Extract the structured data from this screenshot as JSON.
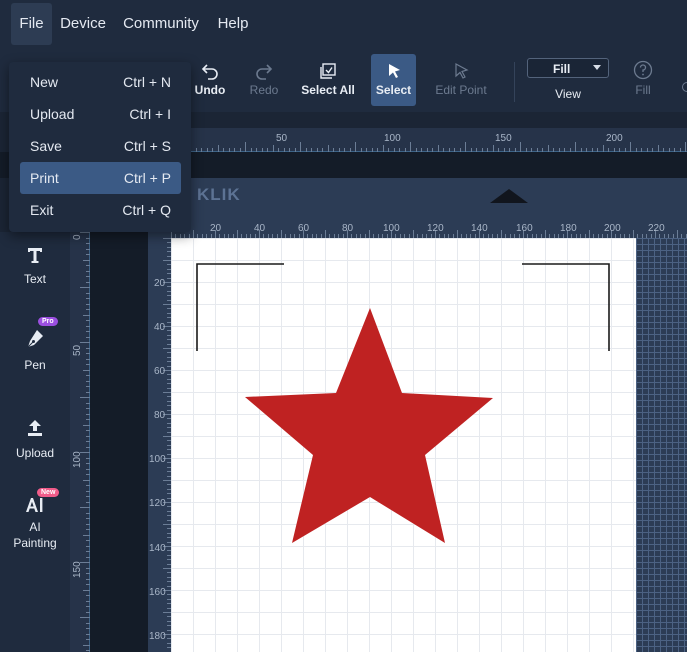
{
  "menubar": {
    "file": "File",
    "device": "Device",
    "community": "Community",
    "help": "Help"
  },
  "file_menu": {
    "items": [
      {
        "label": "New",
        "shortcut": "Ctrl + N"
      },
      {
        "label": "Upload",
        "shortcut": "Ctrl + I"
      },
      {
        "label": "Save",
        "shortcut": "Ctrl + S"
      },
      {
        "label": "Print",
        "shortcut": "Ctrl + P"
      },
      {
        "label": "Exit",
        "shortcut": "Ctrl + Q"
      }
    ],
    "highlighted": "Print"
  },
  "toolbar": {
    "undo": "Undo",
    "redo": "Redo",
    "select_all": "Select All",
    "select": "Select",
    "edit_point": "Edit Point",
    "fill_value": "Fill",
    "view": "View",
    "fill": "Fill"
  },
  "brand": "KLIK",
  "sidebar": {
    "text": "Text",
    "pen": "Pen",
    "pen_badge": "Pro",
    "upload": "Upload",
    "ai_line1": "AI",
    "ai_line2": "Painting",
    "ai_badge": "New"
  },
  "rulers": {
    "strip_top": [
      "50",
      "100",
      "150",
      "200"
    ],
    "strip_left": [
      "0",
      "50",
      "100",
      "150"
    ],
    "canvas_top": [
      "20",
      "40",
      "60",
      "80",
      "100",
      "120",
      "140",
      "160",
      "180",
      "200",
      "220"
    ],
    "canvas_left": [
      "20",
      "40",
      "60",
      "80",
      "100",
      "120",
      "140",
      "160",
      "180"
    ]
  },
  "colors": {
    "accent": "#3b5a85",
    "star": "#bf2222",
    "pro_badge": "#9b4fe0",
    "new_badge": "#f05c8a"
  }
}
